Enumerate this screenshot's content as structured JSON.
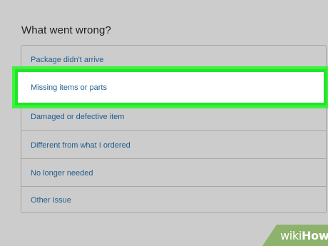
{
  "heading": "What went wrong?",
  "options": [
    "Package didn't arrive",
    "Missing items or parts",
    "Damaged or defective item",
    "Different from what I ordered",
    "No longer needed",
    "Other Issue"
  ],
  "selected_index": 1,
  "watermark": {
    "prefix": "wiki",
    "suffix": "How"
  },
  "colors": {
    "background": "#cccccc",
    "link_text": "#1f5d8f",
    "highlight": "#22e52a",
    "selected_bg": "#ffffff",
    "border": "#a6a6a6",
    "watermark_bg": "#8db26b"
  }
}
